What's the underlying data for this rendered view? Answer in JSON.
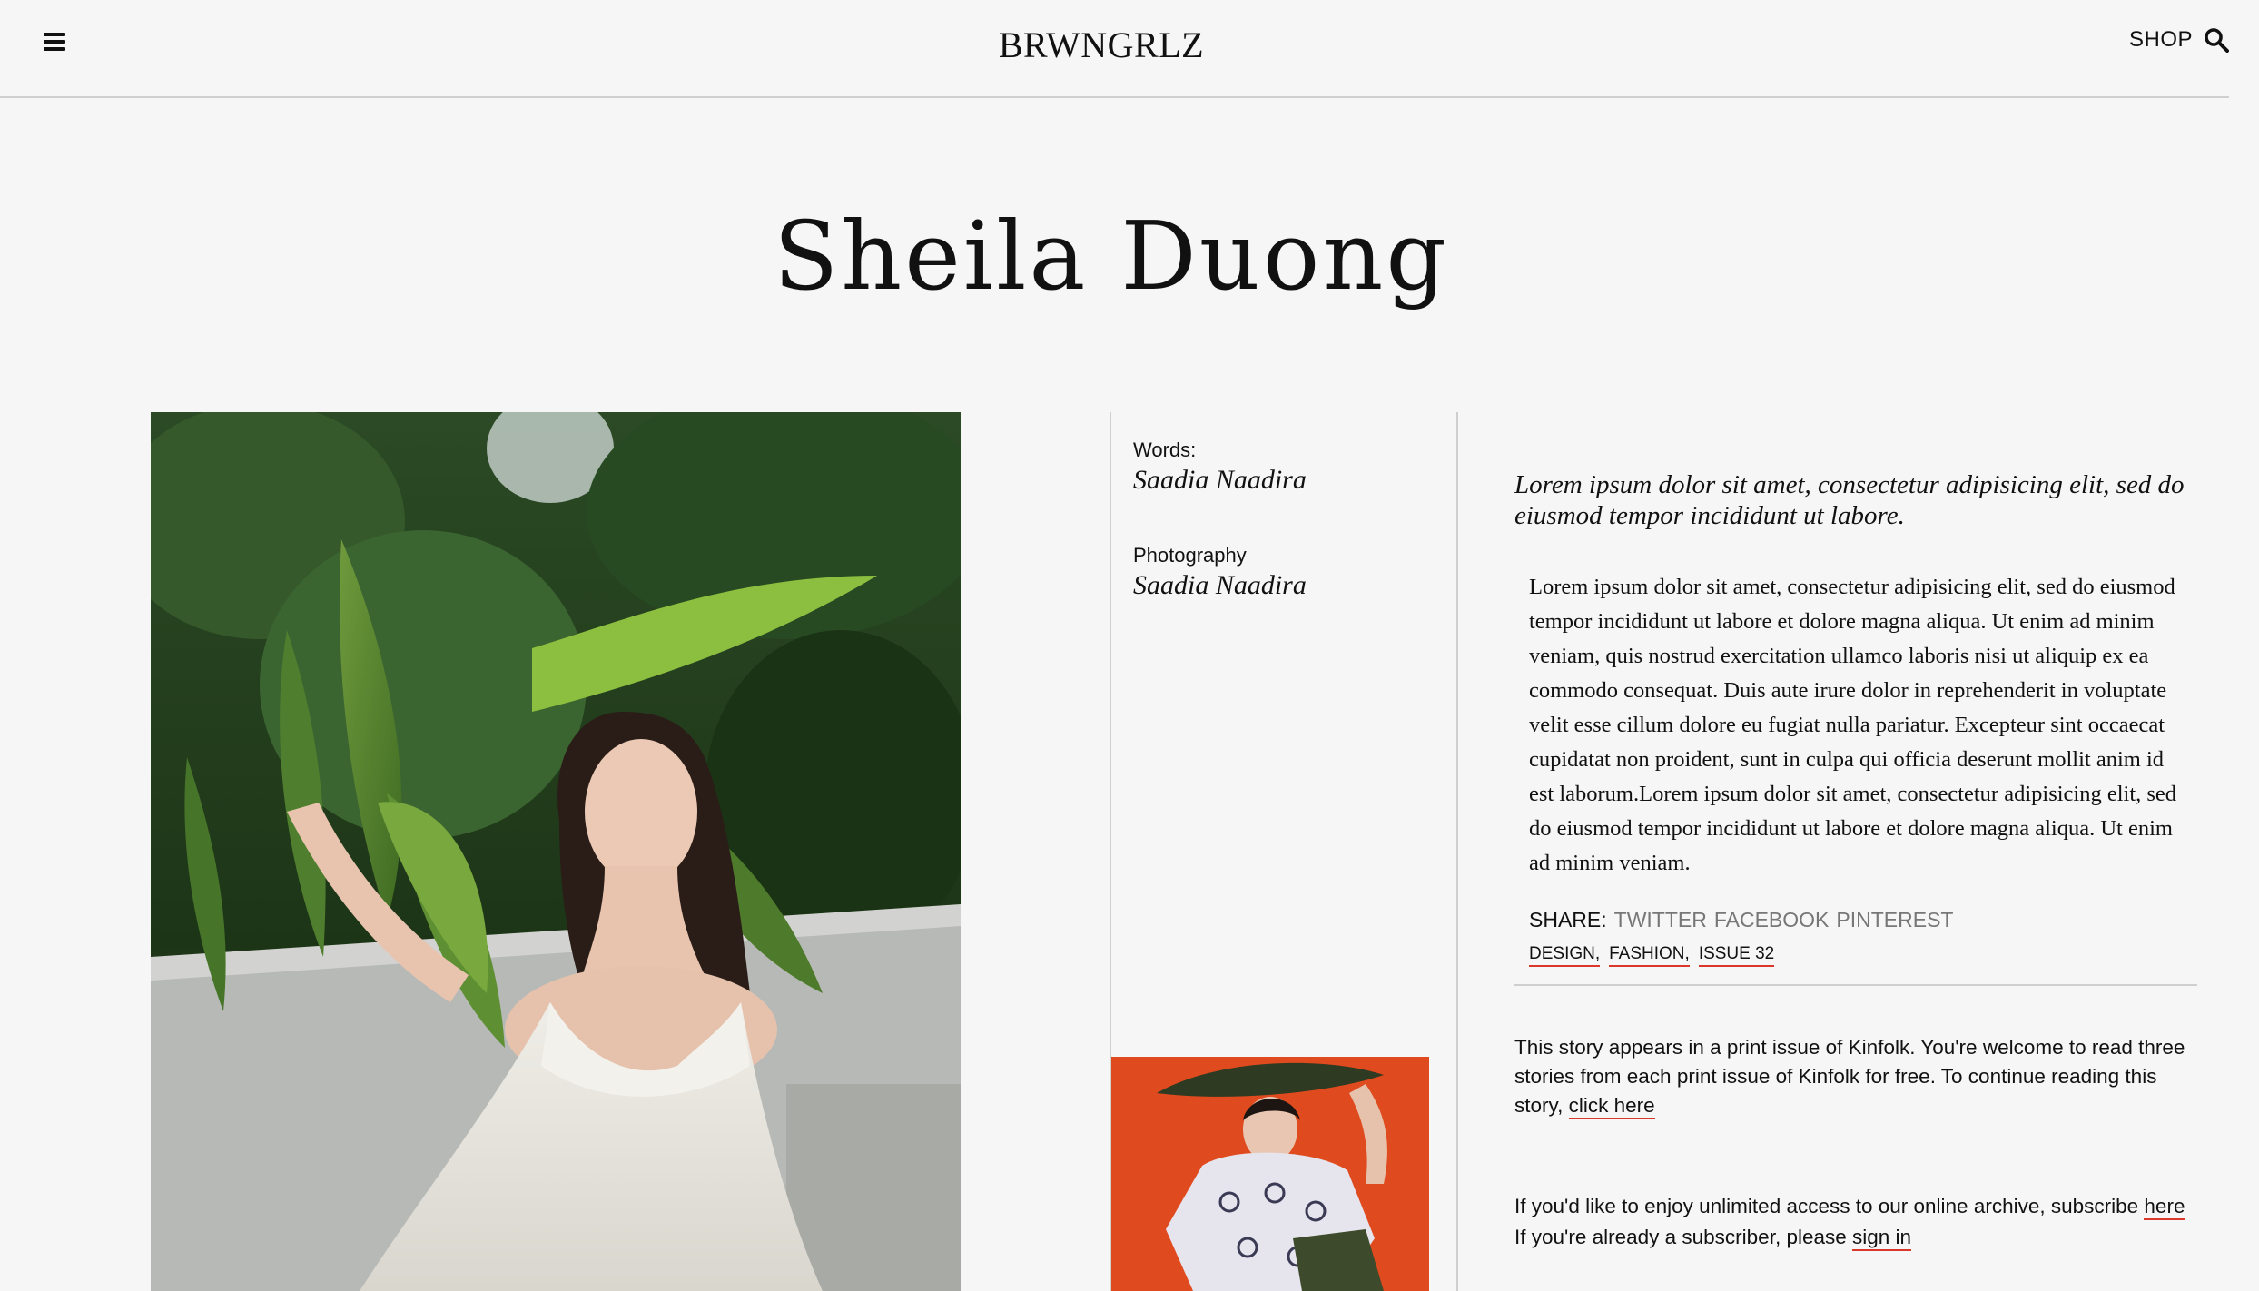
{
  "header": {
    "brand": "BRWNGRLZ",
    "shop_label": "SHOP",
    "menu_icon": "hamburger-menu-icon",
    "search_icon": "search-icon"
  },
  "article": {
    "title": "Sheila Duong",
    "credits": {
      "words_label": "Words:",
      "words_name": "Saadia Naadira",
      "photo_label": "Photography",
      "photo_name": "Saadia Naadira"
    },
    "lede": "Lorem ipsum dolor sit amet, consectetur adipisicing elit, sed do eiusmod tempor incididunt ut labore.",
    "body": "Lorem ipsum dolor sit amet, consectetur adipisicing elit, sed do eiusmod tempor incididunt ut labore et dolore magna aliqua. Ut enim ad minim veniam, quis nostrud exercitation ullamco laboris nisi ut aliquip ex ea commodo consequat. Duis aute irure dolor in reprehenderit in voluptate velit esse cillum dolore eu fugiat nulla pariatur. Excepteur sint occaecat cupidatat non proident, sunt in culpa qui officia deserunt mollit anim id est laborum.Lorem ipsum dolor sit amet, consectetur adipisicing elit, sed do eiusmod tempor incididunt ut labore et dolore magna aliqua. Ut enim ad minim veniam.",
    "share": {
      "label": "SHARE:",
      "links": [
        "TWITTER",
        "FACEBOOK",
        "PINTEREST"
      ]
    },
    "tags": [
      "DESIGN,",
      "FASHION,",
      "ISSUE 32"
    ]
  },
  "notice": {
    "print_text": "This story appears in a print issue of Kinfolk. You're welcome to read three stories from each print issue of Kinfolk for free. To continue reading this story,",
    "print_link": "click here",
    "archive_text": "If you'd like to enjoy unlimited access to our online archive, subscribe",
    "archive_link": "here",
    "signin_text": "If you're already a subscriber, please",
    "signin_link": "sign in"
  },
  "colors": {
    "background": "#f6f6f6",
    "link_underline": "#d9382a",
    "share_link": "#777777",
    "divider": "#cfcfcf"
  }
}
